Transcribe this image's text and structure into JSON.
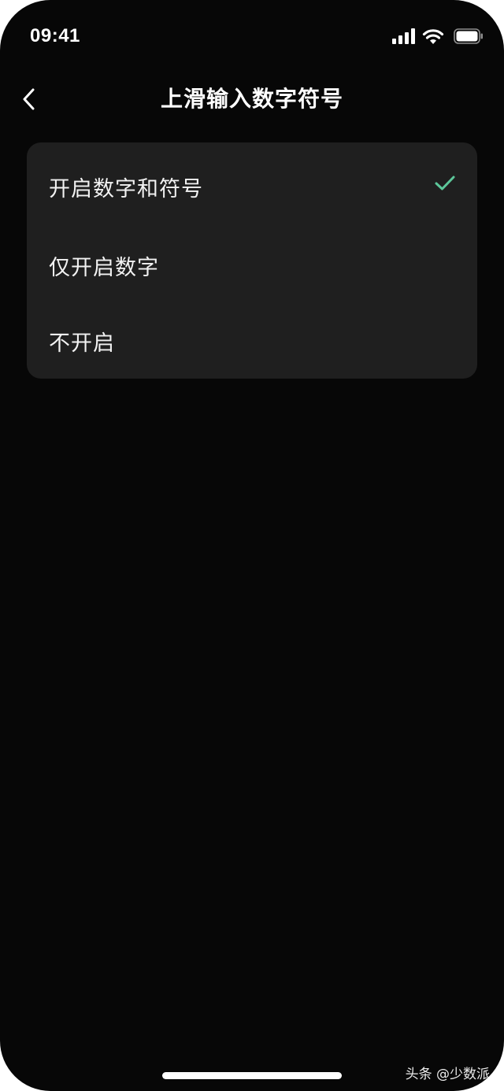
{
  "status_bar": {
    "time": "09:41",
    "icons": [
      "cellular-signal-icon",
      "wifi-icon",
      "battery-icon"
    ]
  },
  "nav": {
    "back_icon": "chevron-left-icon",
    "title": "上滑输入数字符号"
  },
  "options": [
    {
      "label": "开启数字和符号",
      "selected": true
    },
    {
      "label": "仅开启数字",
      "selected": false
    },
    {
      "label": "不开启",
      "selected": false
    }
  ],
  "colors": {
    "background": "#070707",
    "card": "#1f1f1f",
    "check": "#5cc79a",
    "text": "#ffffff"
  },
  "watermark": "头条 @少数派"
}
